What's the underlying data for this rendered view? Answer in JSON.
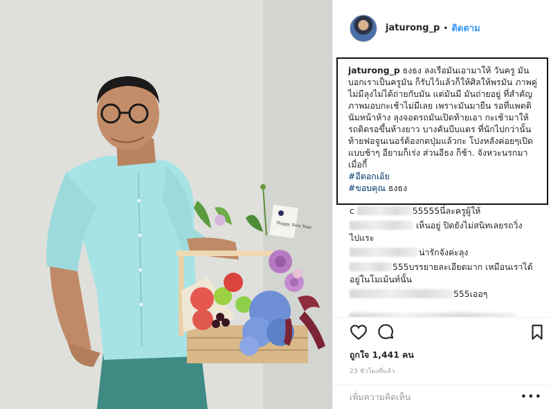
{
  "post": {
    "username": "jaturong_p",
    "dot": "•",
    "follow_label": "ติดตาม",
    "caption": {
      "user": "jaturong_p",
      "lines": [
        " ธงธง ลงเรือมันเอามาให้ วันครู มัน",
        "บอกเราเป็นครูมัน ก็รับไว้แล้วก็ให้ศิลให้พรมัน",
        "ภาพคู่ไม่มีลุงไม่ได้ถ่ายกับมัน แต่มันมี มันถ่ายอยู่",
        "ที่สำคัญภาพมอบกะเช้าไม่มีเลย เพราะมันมายืน",
        "รอที่แพตตินัมหน้าห้าง ลุงจอดรถมันเปิดท้ายเอา",
        "กะเช้ามาให้รถติดรอขึ้นห้างยาว บางคันบีบแตร",
        "ที่นักไปกว่านั้นท้ายฟอจูนเนอร์ต้องกดปุ่มแล้วกะ",
        "โปงหลังค่อยๆเปิดแบบช้าๆ อียามก็เร่ง ส่วนอีธง",
        "ก็ช้า. จังหวะนรกมา เมื่อกี้"
      ],
      "hashtag1": "#อีดอกเอ้ย",
      "hashtag2": "#ขอบคุณ",
      "hashtag2_suffix": " ธงธง"
    },
    "comments": [
      {
        "prefix": "c",
        "text": "55555นี่ละครูผู้ให้"
      },
      {
        "prefix": "",
        "text": " เห็นอยู่ ปิดยังไม่สนิทเลยรถวิ่ง"
      },
      {
        "prefix": "",
        "text": "ไปแระ"
      },
      {
        "prefix": "",
        "text": "น่ารักจังค่ะลุง"
      },
      {
        "prefix": "",
        "text": "555บรรยายละเอียดมาก เหมือนเราได้"
      },
      {
        "prefix": "",
        "text": "อยู่ในโมเม้นท์นั้น"
      },
      {
        "prefix": "",
        "text": "555เออๆ"
      }
    ],
    "likes": "ถูกใจ 1,441 คน",
    "timestamp": "23 ชั่วโมงที่แล้ว",
    "add_comment_placeholder": "เพิ่มความคิดเห็น",
    "more_label": "•••",
    "icons": {
      "like": "heart-icon",
      "comment": "comment-icon",
      "save": "bookmark-icon"
    },
    "colors": {
      "link_blue": "#3897f0",
      "hashtag": "#003569",
      "muted": "#999999",
      "text": "#262626"
    }
  },
  "photo": {
    "card_text": "Happy New Year"
  }
}
